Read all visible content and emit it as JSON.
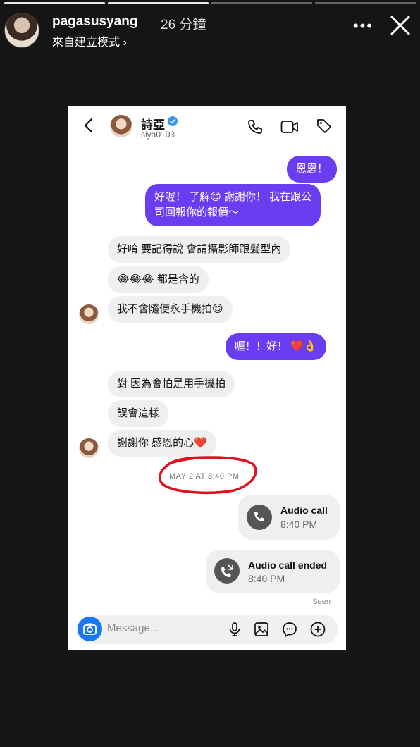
{
  "story": {
    "username": "pagasusyang",
    "time_ago": "26 分鐘",
    "subtitle": "來自建立模式 ›",
    "progress_segments": 4,
    "progress_current_segment": 2,
    "more_icon": "more-horizontal-icon",
    "close_icon": "close-icon"
  },
  "dm": {
    "name": "詩亞",
    "handle": "siya0103",
    "icons": [
      "back-icon",
      "verified-badge-icon",
      "phone-icon",
      "video-icon",
      "tag-icon"
    ],
    "accent_out": "#6b3df0",
    "messages": [
      {
        "side": "out",
        "text": "恩恩！"
      },
      {
        "side": "out",
        "line1": "好喔！ 了解😊 謝謝你！ 我在跟公",
        "line2": "司回報你的報價～"
      },
      {
        "side": "in",
        "text": "好唷 要記得說 會請攝影師跟髮型內"
      },
      {
        "side": "in",
        "text": "😂😂😂 都是含的"
      },
      {
        "side": "in",
        "text": "我不會隨便永手機拍😊"
      },
      {
        "side": "out",
        "text": "喔！！好！ ❤️👌"
      },
      {
        "side": "in",
        "text": "對 因為會怕是用手機拍"
      },
      {
        "side": "in",
        "text": "誤會這樣"
      },
      {
        "side": "in",
        "text": "謝謝你 感恩的心❤️"
      }
    ],
    "timestamp": "MAY 2 AT 8:40 PM",
    "annotation_color": "#e0101e",
    "calls": [
      {
        "title": "Audio call",
        "time": "8:40 PM",
        "icon": "phone-call-icon"
      },
      {
        "title": "Audio call ended",
        "time": "8:40 PM",
        "icon": "missed-call-icon"
      }
    ],
    "seen": "Seen",
    "composer": {
      "placeholder": "Message...",
      "icons": [
        "camera-icon",
        "microphone-icon",
        "image-icon",
        "sticker-icon",
        "plus-icon"
      ]
    }
  }
}
